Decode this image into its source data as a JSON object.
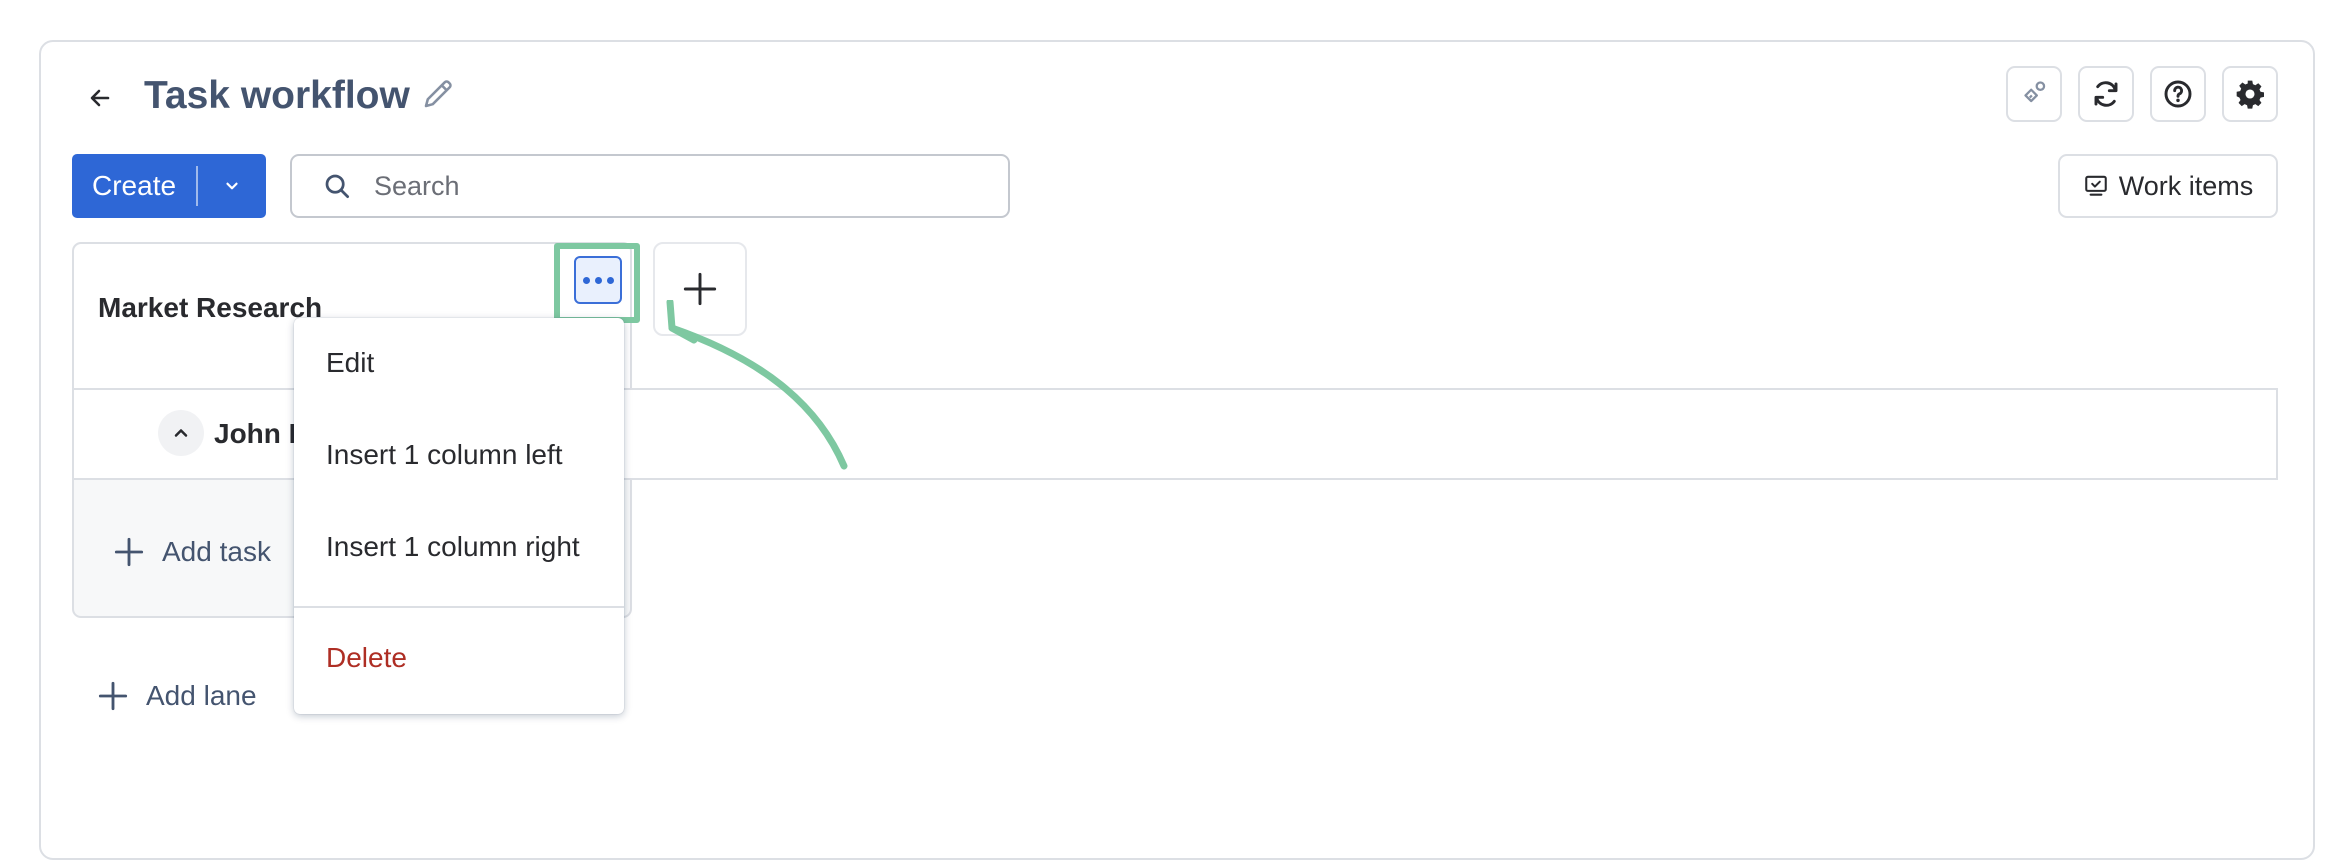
{
  "header": {
    "title": "Task workflow",
    "back_icon": "arrow-left-icon",
    "edit_icon": "pencil-icon",
    "actions": [
      {
        "name": "automation-icon"
      },
      {
        "name": "refresh-icon"
      },
      {
        "name": "help-icon"
      },
      {
        "name": "settings-gear-icon"
      }
    ]
  },
  "toolbar": {
    "create_label": "Create",
    "search_placeholder": "Search",
    "work_items_label": "Work items"
  },
  "board": {
    "column_title": "Market Research",
    "lane_name": "John D",
    "add_task_label": "Add task",
    "add_lane_label": "Add lane"
  },
  "menu": {
    "items": [
      {
        "label": "Edit"
      },
      {
        "label": "Insert 1 column left"
      },
      {
        "label": "Insert 1 column right"
      },
      {
        "label": "Delete"
      }
    ]
  },
  "colors": {
    "primary": "#2e67d6",
    "highlight": "#7ec8a1",
    "danger": "#ae2e24",
    "title": "#44546f"
  }
}
